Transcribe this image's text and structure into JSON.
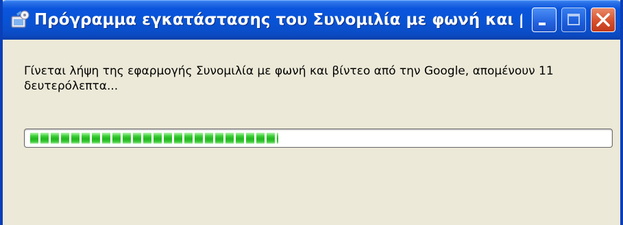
{
  "window": {
    "title": "Πρόγραμμα εγκατάστασης του Συνομιλία με φωνή και β...",
    "icon": "installer-setup-icon",
    "controls": {
      "minimize": "minimize-icon",
      "maximize": "maximize-icon",
      "close": "close-icon"
    }
  },
  "content": {
    "message": "Γίνεται λήψη της εφαρμογής Συνομιλία με φωνή και βίντεο από την Google, απομένουν 11 δευτερόλεπτα..."
  },
  "progress": {
    "fraction": 0.43,
    "segments": 24,
    "fill_color": "#2fc22b"
  },
  "colors": {
    "titlebar": "#0a55dd",
    "frame": "#0a3fb8",
    "background": "#ece9d8",
    "close_button": "#d7502c"
  }
}
